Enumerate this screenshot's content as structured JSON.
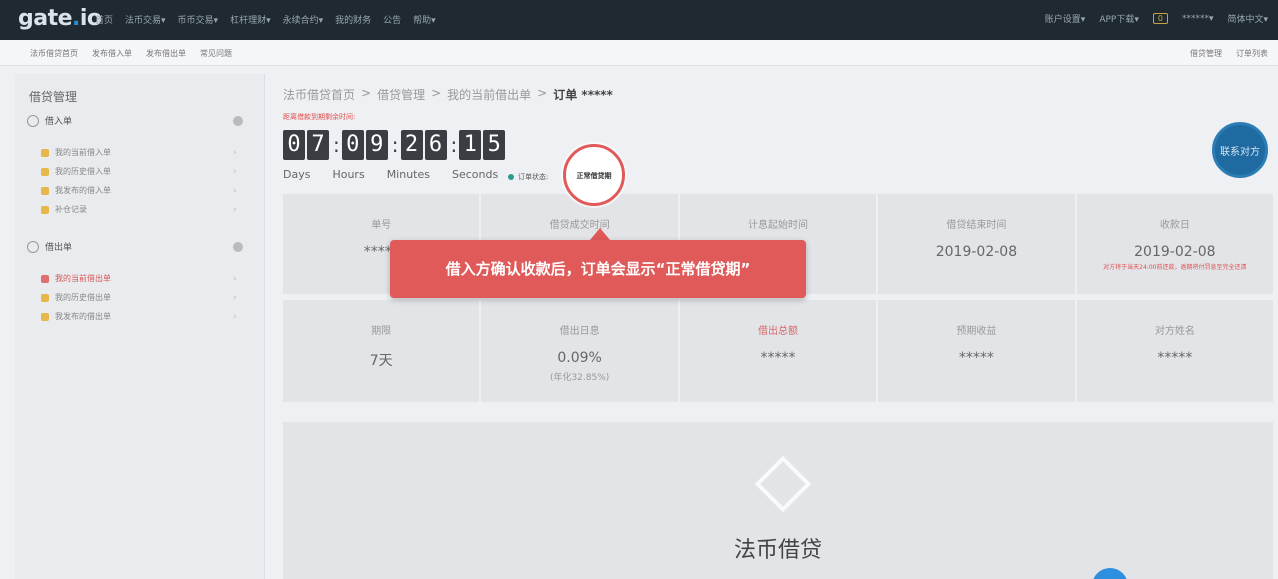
{
  "header": {
    "logo": "gate.io",
    "nav": [
      "首页",
      "法币交易▾",
      "币币交易▾",
      "杠杆理财▾",
      "永续合约▾",
      "我的财务",
      "公告",
      "帮助▾"
    ],
    "right": [
      "账户设置▾",
      "APP下载▾",
      "0",
      "******▾",
      "简体中文▾"
    ]
  },
  "subnav": {
    "left": [
      "法币借贷首页",
      "发布借入单",
      "发布借出单",
      "常见问题"
    ],
    "right": [
      "借贷管理",
      "订单列表"
    ]
  },
  "sidebar": {
    "title": "借贷管理",
    "sections": [
      {
        "label": "借入单",
        "items": [
          "我的当前借入单",
          "我的历史借入单",
          "我发布的借入单",
          "补仓记录"
        ]
      },
      {
        "label": "借出单",
        "items": [
          "我的当前借出单",
          "我的历史借出单",
          "我发布的借出单"
        ]
      }
    ],
    "active_item": "我的当前借出单"
  },
  "breadcrumb": [
    "法币借贷首页",
    ">",
    "借贷管理",
    ">",
    "我的当前借出单",
    ">",
    "订单 *****"
  ],
  "deadline_text": "距离借款到期剩余时间:",
  "countdown": {
    "digits": [
      "0",
      "7",
      "0",
      "9",
      "2",
      "6",
      "1",
      "5"
    ],
    "labels": [
      "Days",
      "Hours",
      "Minutes",
      "Seconds"
    ]
  },
  "order_status": {
    "label": "订单状态:",
    "value": "正常借贷期"
  },
  "row1": [
    {
      "label": "单号",
      "value": "*****"
    },
    {
      "label": "借贷成交时间",
      "value": ""
    },
    {
      "label": "计息起始时间",
      "value": ""
    },
    {
      "label": "借贷结束时间",
      "value": "2019-02-08"
    },
    {
      "label": "收款日",
      "value": "2019-02-08",
      "note": "对方将于当天24:00前还款，逾期将付罚息至完全还清"
    }
  ],
  "row2": [
    {
      "label": "期限",
      "value": "7天"
    },
    {
      "label": "借出日息",
      "value": "0.09%",
      "sub": "(年化32.85%)"
    },
    {
      "label": "借出总额",
      "value": "*****"
    },
    {
      "label": "预期收益",
      "value": "*****"
    },
    {
      "label": "对方姓名",
      "value": "*****"
    }
  ],
  "panel": {
    "title": "法币借贷"
  },
  "contact_button": "联系对方",
  "tooltip": "借入方确认收款后，订单会显示“正常借贷期”",
  "highlight_text": "正常借贷期"
}
